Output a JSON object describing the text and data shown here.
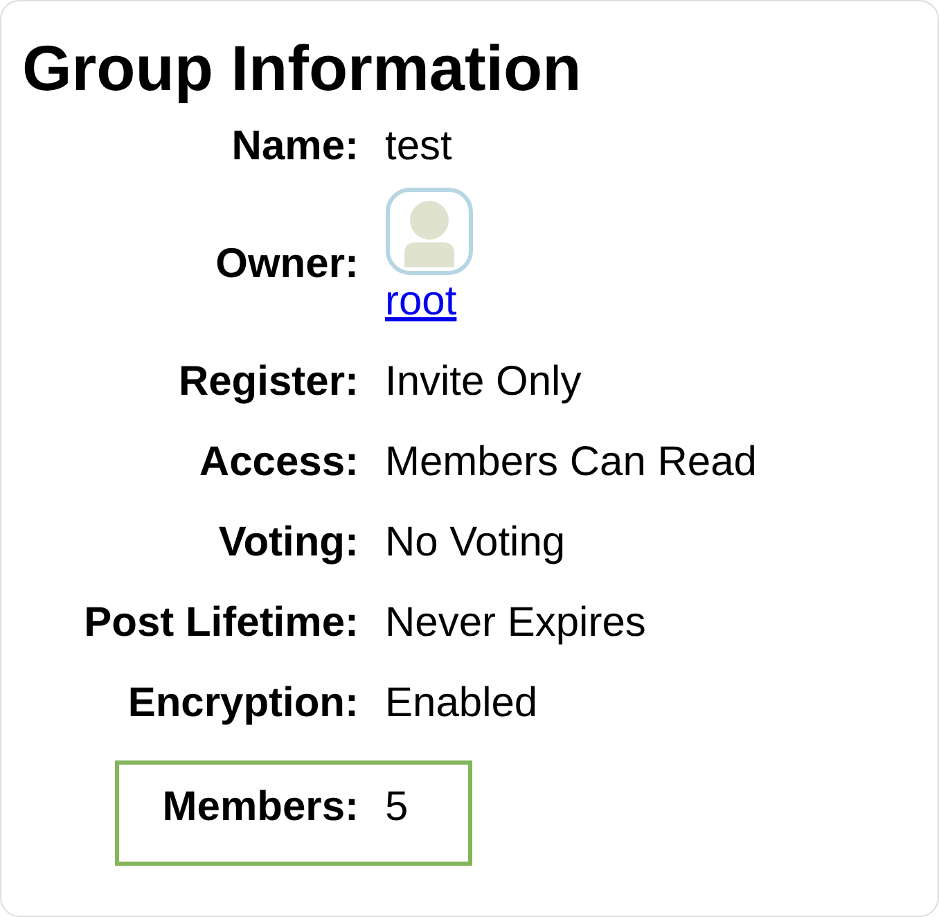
{
  "title": "Group Information",
  "rows": [
    {
      "label": "Name:",
      "kind": "text",
      "value": "test",
      "highlighted": false
    },
    {
      "label": "Owner:",
      "kind": "user",
      "value": "root",
      "highlighted": false
    },
    {
      "label": "Register:",
      "kind": "text",
      "value": "Invite Only",
      "highlighted": false
    },
    {
      "label": "Access:",
      "kind": "text",
      "value": "Members Can Read",
      "highlighted": false
    },
    {
      "label": "Voting:",
      "kind": "text",
      "value": "No Voting",
      "highlighted": false
    },
    {
      "label": "Post Lifetime:",
      "kind": "text",
      "value": "Never Expires",
      "highlighted": false
    },
    {
      "label": "Encryption:",
      "kind": "text",
      "value": "Enabled",
      "highlighted": false
    },
    {
      "label": "Members:",
      "kind": "text",
      "value": "5",
      "highlighted": true
    }
  ]
}
